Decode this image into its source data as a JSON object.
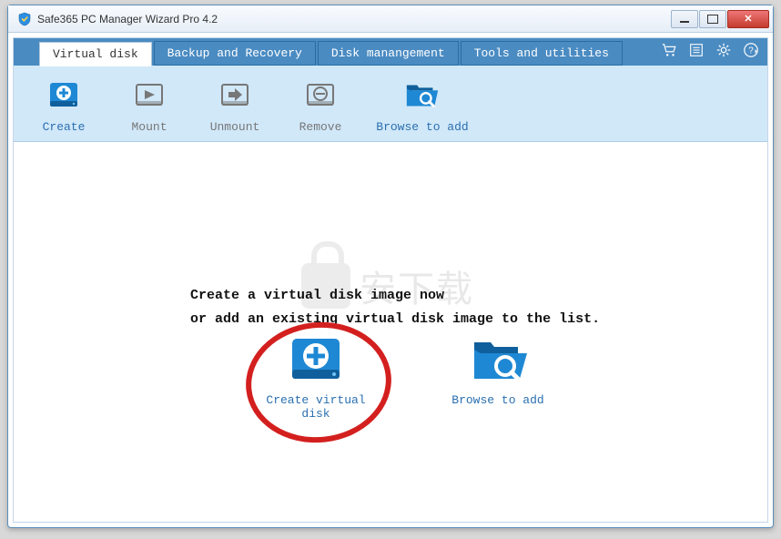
{
  "window": {
    "title": "Safe365 PC Manager Wizard Pro 4.2"
  },
  "tabs": [
    {
      "label": "Virtual disk",
      "active": true
    },
    {
      "label": "Backup and Recovery",
      "active": false
    },
    {
      "label": "Disk manangement",
      "active": false
    },
    {
      "label": "Tools and utilities",
      "active": false
    }
  ],
  "toolbar": {
    "create": "Create",
    "mount": "Mount",
    "unmount": "Unmount",
    "remove": "Remove",
    "browse": "Browse to add"
  },
  "main": {
    "line1": "Create a virtual disk image now",
    "line2": "or add an existing virtual disk image to the list.",
    "create_label": "Create virtual disk",
    "browse_label": "Browse to add"
  },
  "watermark": "安下载"
}
